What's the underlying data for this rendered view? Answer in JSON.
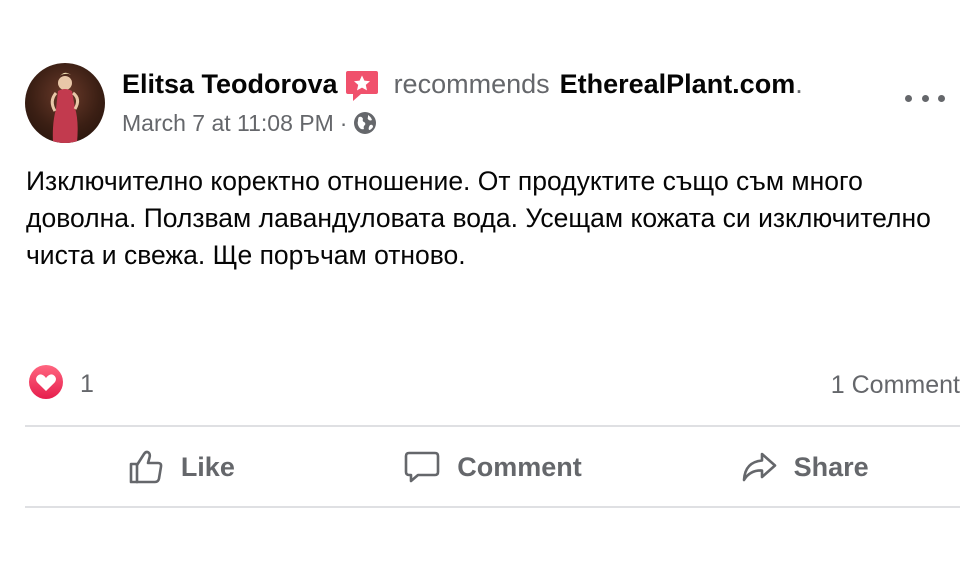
{
  "post": {
    "author": "Elitsa Teodorova",
    "recommends_text": "recommends",
    "page_name": "EtherealPlant.com",
    "page_name_suffix": ".",
    "timestamp": "March 7 at 11:08 PM",
    "meta_separator": "·",
    "privacy_icon": "globe-icon",
    "text": "Изключително коректно отношение. От продуктите също съм много доволна. Ползвам лавандуловата вода. Усещам кожата си изключително чиста и свежа. Ще поръчам отново."
  },
  "reactions": {
    "icon": "heart-reaction-icon",
    "count": "1"
  },
  "comments": {
    "count_label": "1 Comment"
  },
  "actions": {
    "like": "Like",
    "comment": "Comment",
    "share": "Share"
  },
  "colors": {
    "text": "#050505",
    "secondary": "#65676b",
    "recommend_badge": "#f0516c",
    "heart": "#f33e58",
    "divider": "#dfe0e3"
  }
}
